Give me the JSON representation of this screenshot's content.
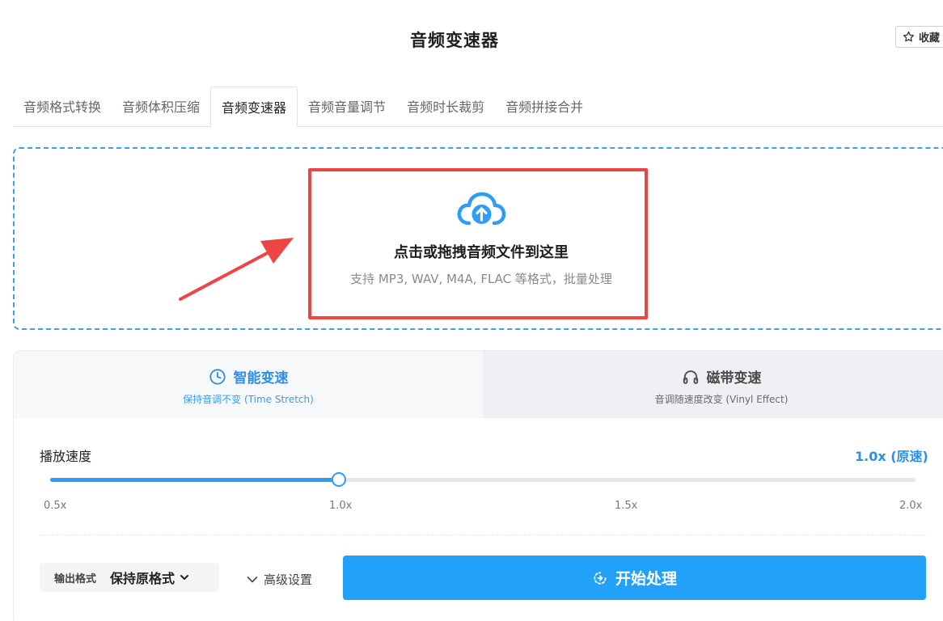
{
  "header": {
    "title": "音频变速器",
    "favorite_label": "收藏"
  },
  "tabs": [
    {
      "label": "音频格式转换",
      "active": false
    },
    {
      "label": "音频体积压缩",
      "active": false
    },
    {
      "label": "音频变速器",
      "active": true
    },
    {
      "label": "音频音量调节",
      "active": false
    },
    {
      "label": "音频时长裁剪",
      "active": false
    },
    {
      "label": "音频拼接合并",
      "active": false
    }
  ],
  "upload": {
    "title": "点击或拖拽音频文件到这里",
    "subtitle": "支持 MP3, WAV, M4A, FLAC 等格式，批量处理",
    "icon": "cloud-upload-icon"
  },
  "modes": [
    {
      "title": "智能变速",
      "subtitle": "保持音调不变 (Time Stretch)",
      "icon": "clock-icon",
      "active": true
    },
    {
      "title": "磁带变速",
      "subtitle": "音调随速度改变 (Vinyl Effect)",
      "icon": "headphones-icon",
      "active": false
    }
  ],
  "speed": {
    "label": "播放速度",
    "value_text": "1.0x (原速)",
    "value": 1.0,
    "min": 0.5,
    "max": 2.0,
    "ticks": [
      "0.5x",
      "1.0x",
      "1.5x",
      "2.0x"
    ]
  },
  "output": {
    "label": "输出格式",
    "value": "保持原格式"
  },
  "advanced_label": "高级设置",
  "start_label": "开始处理",
  "colors": {
    "accent": "#2f9df4",
    "button": "#23a0f8",
    "highlight": "#ee4444"
  }
}
